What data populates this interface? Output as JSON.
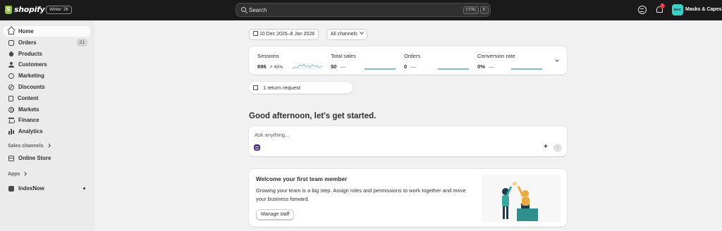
{
  "topbar": {
    "logo_text": "shopify",
    "edition": "Winter '26",
    "search_placeholder": "Search",
    "shortcut_ctrl": "CTRL",
    "shortcut_k": "K",
    "notification_count": "1",
    "avatar_initials": "MAC",
    "store_name": "Masks & Capes"
  },
  "sidebar": {
    "items": [
      {
        "label": "Home",
        "icon": "home-icon"
      },
      {
        "label": "Orders",
        "icon": "orders-icon",
        "count": "21"
      },
      {
        "label": "Products",
        "icon": "tag-icon"
      },
      {
        "label": "Customers",
        "icon": "person-icon"
      },
      {
        "label": "Marketing",
        "icon": "target-icon"
      },
      {
        "label": "Discounts",
        "icon": "discount-icon"
      },
      {
        "label": "Content",
        "icon": "content-icon"
      },
      {
        "label": "Markets",
        "icon": "globe-icon"
      },
      {
        "label": "Finance",
        "icon": "bank-icon"
      },
      {
        "label": "Analytics",
        "icon": "bar-chart-icon"
      }
    ],
    "sales_channels_heading": "Sales channels",
    "online_store": "Online Store",
    "apps_heading": "Apps",
    "app_item": "IndexNow"
  },
  "main": {
    "date_range": "10 Dec 2025–8 Jan 2026",
    "channel_filter": "All channels",
    "metrics": [
      {
        "label": "Sessions",
        "value": "896",
        "change": "↗ 43%"
      },
      {
        "label": "Total sales",
        "value": "$0",
        "change": "—"
      },
      {
        "label": "Orders",
        "value": "0",
        "change": "—"
      },
      {
        "label": "Conversion rate",
        "value": "0%",
        "change": "—"
      }
    ],
    "returns_text": "1 return request",
    "greeting": "Good afternoon, let's get started.",
    "ask_placeholder": "Ask anything...",
    "welcome": {
      "title": "Welcome your first team member",
      "body": "Growing your team is a big step. Assign roles and permissions to work together and move your business forward.",
      "button": "Manage staff"
    }
  },
  "colors": {
    "topbar": "#1a1a1a",
    "accent_teal": "#36cfc9",
    "sparkline": "#7fb6ea",
    "sidekick": "#4b2ea1"
  }
}
